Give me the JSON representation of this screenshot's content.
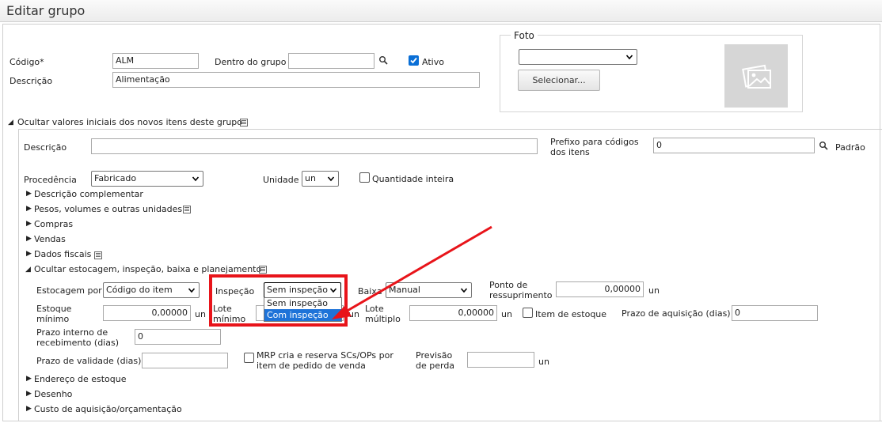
{
  "window": {
    "title": "Editar grupo"
  },
  "form": {
    "codigo_label": "Código*",
    "codigo_value": "ALM",
    "dentro_label": "Dentro do grupo",
    "dentro_value": "",
    "ativo_label": "Ativo",
    "ativo_checked": true,
    "descricao_label": "Descrição",
    "descricao_value": "Alimentação"
  },
  "foto": {
    "legend": "Foto",
    "select_value": "",
    "button_label": "Selecionar..."
  },
  "section_main": {
    "title": "Ocultar valores iniciais dos novos itens deste grupo"
  },
  "items": {
    "descricao_label": "Descrição",
    "descricao_value": "",
    "prefixo_label_1": "Prefixo para códigos",
    "prefixo_label_2": "dos itens",
    "prefixo_value": "0",
    "padrao_label": "Padrão",
    "procedencia_label": "Procedência",
    "procedencia_value": "Fabricado",
    "unidade_label": "Unidade",
    "unidade_value": "un",
    "qtd_inteira_label": "Quantidade inteira"
  },
  "collapsibles": [
    {
      "label": "Descrição complementar"
    },
    {
      "label": "Pesos, volumes e outras unidades"
    },
    {
      "label": "Compras"
    },
    {
      "label": "Vendas"
    },
    {
      "label": "Dados fiscais"
    }
  ],
  "estoque_section": {
    "title": "Ocultar estocagem, inspeção, baixa e planejamento"
  },
  "estoque": {
    "estocagem_label": "Estocagem por",
    "estocagem_value": "Código do item",
    "inspecao_label": "Inspeção",
    "inspecao_value": "Sem inspeção",
    "inspecao_options": [
      "Sem inspeção",
      "Com inspeção"
    ],
    "baixa_label": "Baixa",
    "baixa_value": "Manual",
    "ponto_label_1": "Ponto de",
    "ponto_label_2": "ressuprimento",
    "ponto_value": "0,00000",
    "un": "un",
    "estoque_min_label_1": "Estoque",
    "estoque_min_label_2": "mínimo",
    "estoque_min_value": "0,00000",
    "lote_min_label_1": "Lote",
    "lote_min_label_2": "mínimo",
    "lote_mult_label_1": "Lote",
    "lote_mult_label_2": "múltiplo",
    "lote_mult_value": "0,00000",
    "item_estoque_label": "Item de estoque",
    "prazo_aquisicao_label": "Prazo de aquisição (dias)",
    "prazo_aquisicao_value": "0",
    "prazo_interno_label_1": "Prazo interno de",
    "prazo_interno_label_2": "recebimento (dias)",
    "prazo_interno_value": "0",
    "prazo_validade_label": "Prazo de validade (dias)",
    "prazo_validade_value": "",
    "mrp_label_1": "MRP cria e reserva SCs/OPs por",
    "mrp_label_2": "item de pedido de venda",
    "previsao_label_1": "Previsão",
    "previsao_label_2": "de perda",
    "previsao_value": ""
  },
  "collapsibles_bottom": [
    {
      "label": "Endereço de estoque"
    },
    {
      "label": "Desenho"
    },
    {
      "label": "Custo de aquisição/orçamentação"
    }
  ],
  "colors": {
    "highlight": "#e8141a",
    "accent": "#0a6fd6"
  }
}
